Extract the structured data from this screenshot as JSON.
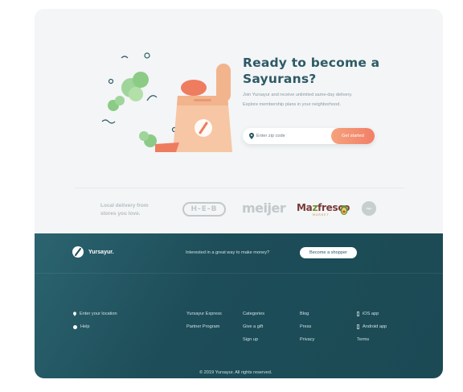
{
  "hero": {
    "title_line1": "Ready to become a",
    "title_line2": "Sayurans?",
    "desc_line1": "Join Yursayur and receive unlimited same-day delivery.",
    "desc_line2": "Explore membership plans in your neighborhood.",
    "zip_placeholder": "Enter zip code",
    "cta_label": "Get started"
  },
  "stores": {
    "heading_line1": "Local delivery from",
    "heading_line2": "stores you love.",
    "logos": {
      "heb": "H-E-B",
      "meijer": "meijer",
      "mazfresco_a": "Ma",
      "mazfresco_z": "z",
      "mazfresco_b": "fresco",
      "mazfresco_sub": "MARKET",
      "circle": "logo"
    }
  },
  "footer": {
    "brand": "Yursayur.",
    "money_text": "Interested in a great way to make money?",
    "shopper_cta": "Become a shopper",
    "col1": {
      "location": "Enter your location",
      "help": "Help"
    },
    "col2": [
      "Yursayur Express",
      "Partner Program"
    ],
    "col3": [
      "Categories",
      "Give a gift",
      "Sign up"
    ],
    "col4": [
      "Blog",
      "Press",
      "Privacy"
    ],
    "col5": [
      "iOS app",
      "Android app",
      "Terms"
    ],
    "copyright": "© 2019 Yursayur. All rights reserved."
  },
  "colors": {
    "accent": "#f27f68",
    "heading": "#2d5a66",
    "footer_bg": "#1d4d58"
  },
  "icons": [
    "location-pin-icon",
    "help-icon",
    "phone-icon",
    "brand-leaf-icon"
  ]
}
